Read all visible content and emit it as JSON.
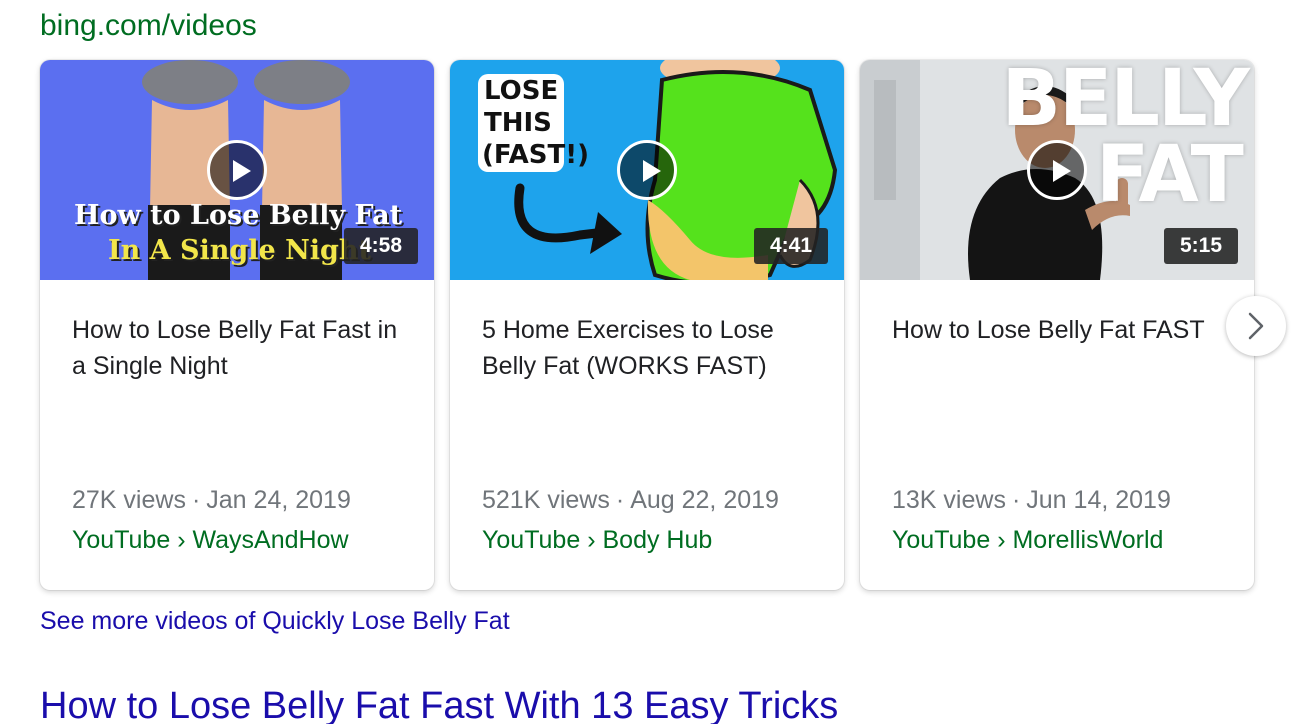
{
  "source_url": "bing.com/videos",
  "videos": [
    {
      "thumb_caption_line1": "How to Lose Belly Fat",
      "thumb_caption_line2": "In A Single Night",
      "duration": "4:58",
      "title": "How to Lose Belly Fat Fast in a Single Night",
      "views": "27K views",
      "date": "Jan 24, 2019",
      "platform": "YouTube",
      "channel": "WaysAndHow"
    },
    {
      "thumb_caption_line1": "LOSE",
      "thumb_caption_line2": "THIS",
      "thumb_caption_line3": "(FAST!)",
      "duration": "4:41",
      "title": "5 Home Exercises to Lose Belly Fat (WORKS FAST)",
      "views": "521K views",
      "date": "Aug 22, 2019",
      "platform": "YouTube",
      "channel": "Body Hub"
    },
    {
      "thumb_caption_line1": "BELLY",
      "thumb_caption_line2": "FAT",
      "duration": "5:15",
      "title": "How to Lose Belly Fat FAST",
      "views": "13K views",
      "date": "Jun 14, 2019",
      "platform": "YouTube",
      "channel": "MorellisWorld"
    }
  ],
  "separator": "·",
  "breadcrumb_sep": "›",
  "see_more": "See more videos of Quickly Lose Belly Fat",
  "next_result_title": "How to Lose Belly Fat Fast With 13 Easy Tricks",
  "colors": {
    "link_blue": "#1a0dab",
    "url_green": "#006d21",
    "meta_gray": "#70757a"
  }
}
